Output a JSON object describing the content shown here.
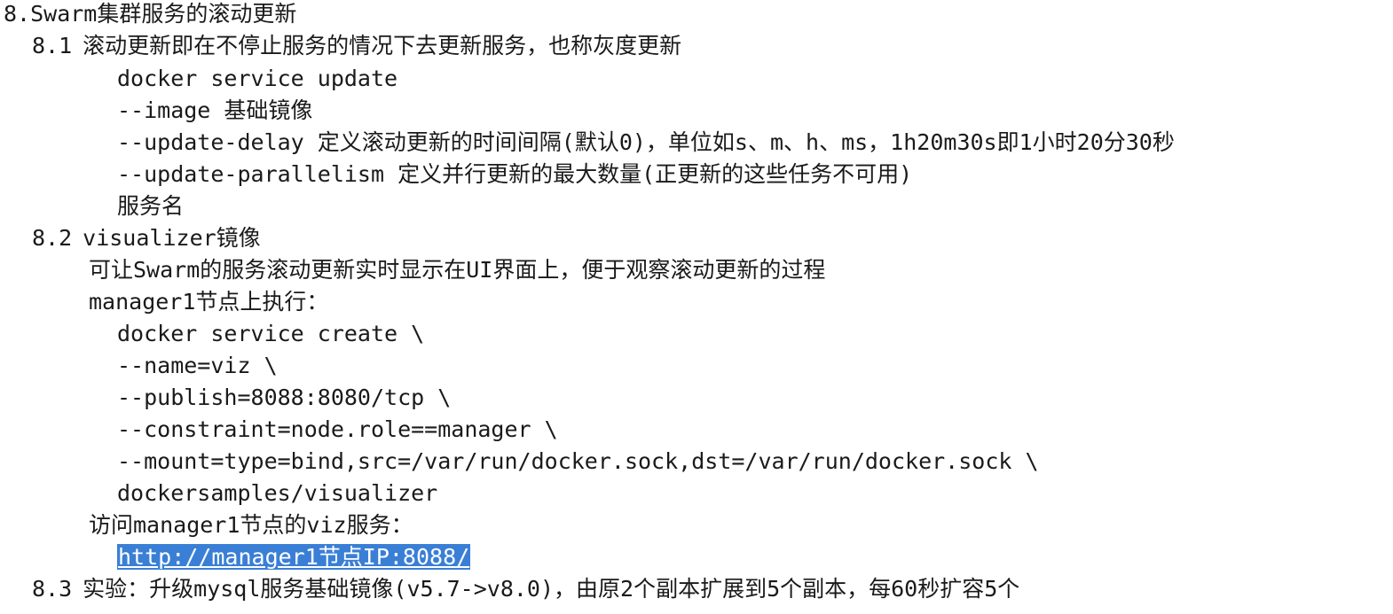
{
  "title": "8.Swarm集群服务的滚动更新",
  "section_81": {
    "number": "8.1",
    "heading": "滚动更新即在不停止服务的情况下去更新服务，也称灰度更新",
    "code_lines": [
      "docker service update",
      "--image 基础镜像",
      "--update-delay 定义滚动更新的时间间隔(默认0)，单位如s、m、h、ms，1h20m30s即1小时20分30秒",
      "--update-parallelism 定义并行更新的最大数量(正更新的这些任务不可用)",
      "服务名"
    ]
  },
  "section_82": {
    "number": "8.2",
    "heading": "visualizer镜像",
    "description": "可让Swarm的服务滚动更新实时显示在UI界面上，便于观察滚动更新的过程",
    "run_on": "manager1节点上执行：",
    "code_lines": [
      "docker service create \\",
      "--name=viz \\",
      "--publish=8088:8080/tcp \\",
      "--constraint=node.role==manager \\",
      "--mount=type=bind,src=/var/run/docker.sock,dst=/var/run/docker.sock \\",
      "dockersamples/visualizer"
    ],
    "access_label": "访问manager1节点的viz服务：",
    "access_url": "http://manager1节点IP:8088/"
  },
  "section_83": {
    "number": "8.3",
    "heading": "实验：升级mysql服务基础镜像(v5.7->v8.0)，由原2个副本扩展到5个副本，每60秒扩容5个"
  },
  "colors": {
    "text": "#1a1a1a",
    "selection_bg": "#3a7fd6",
    "selection_text": "#ffffff"
  }
}
